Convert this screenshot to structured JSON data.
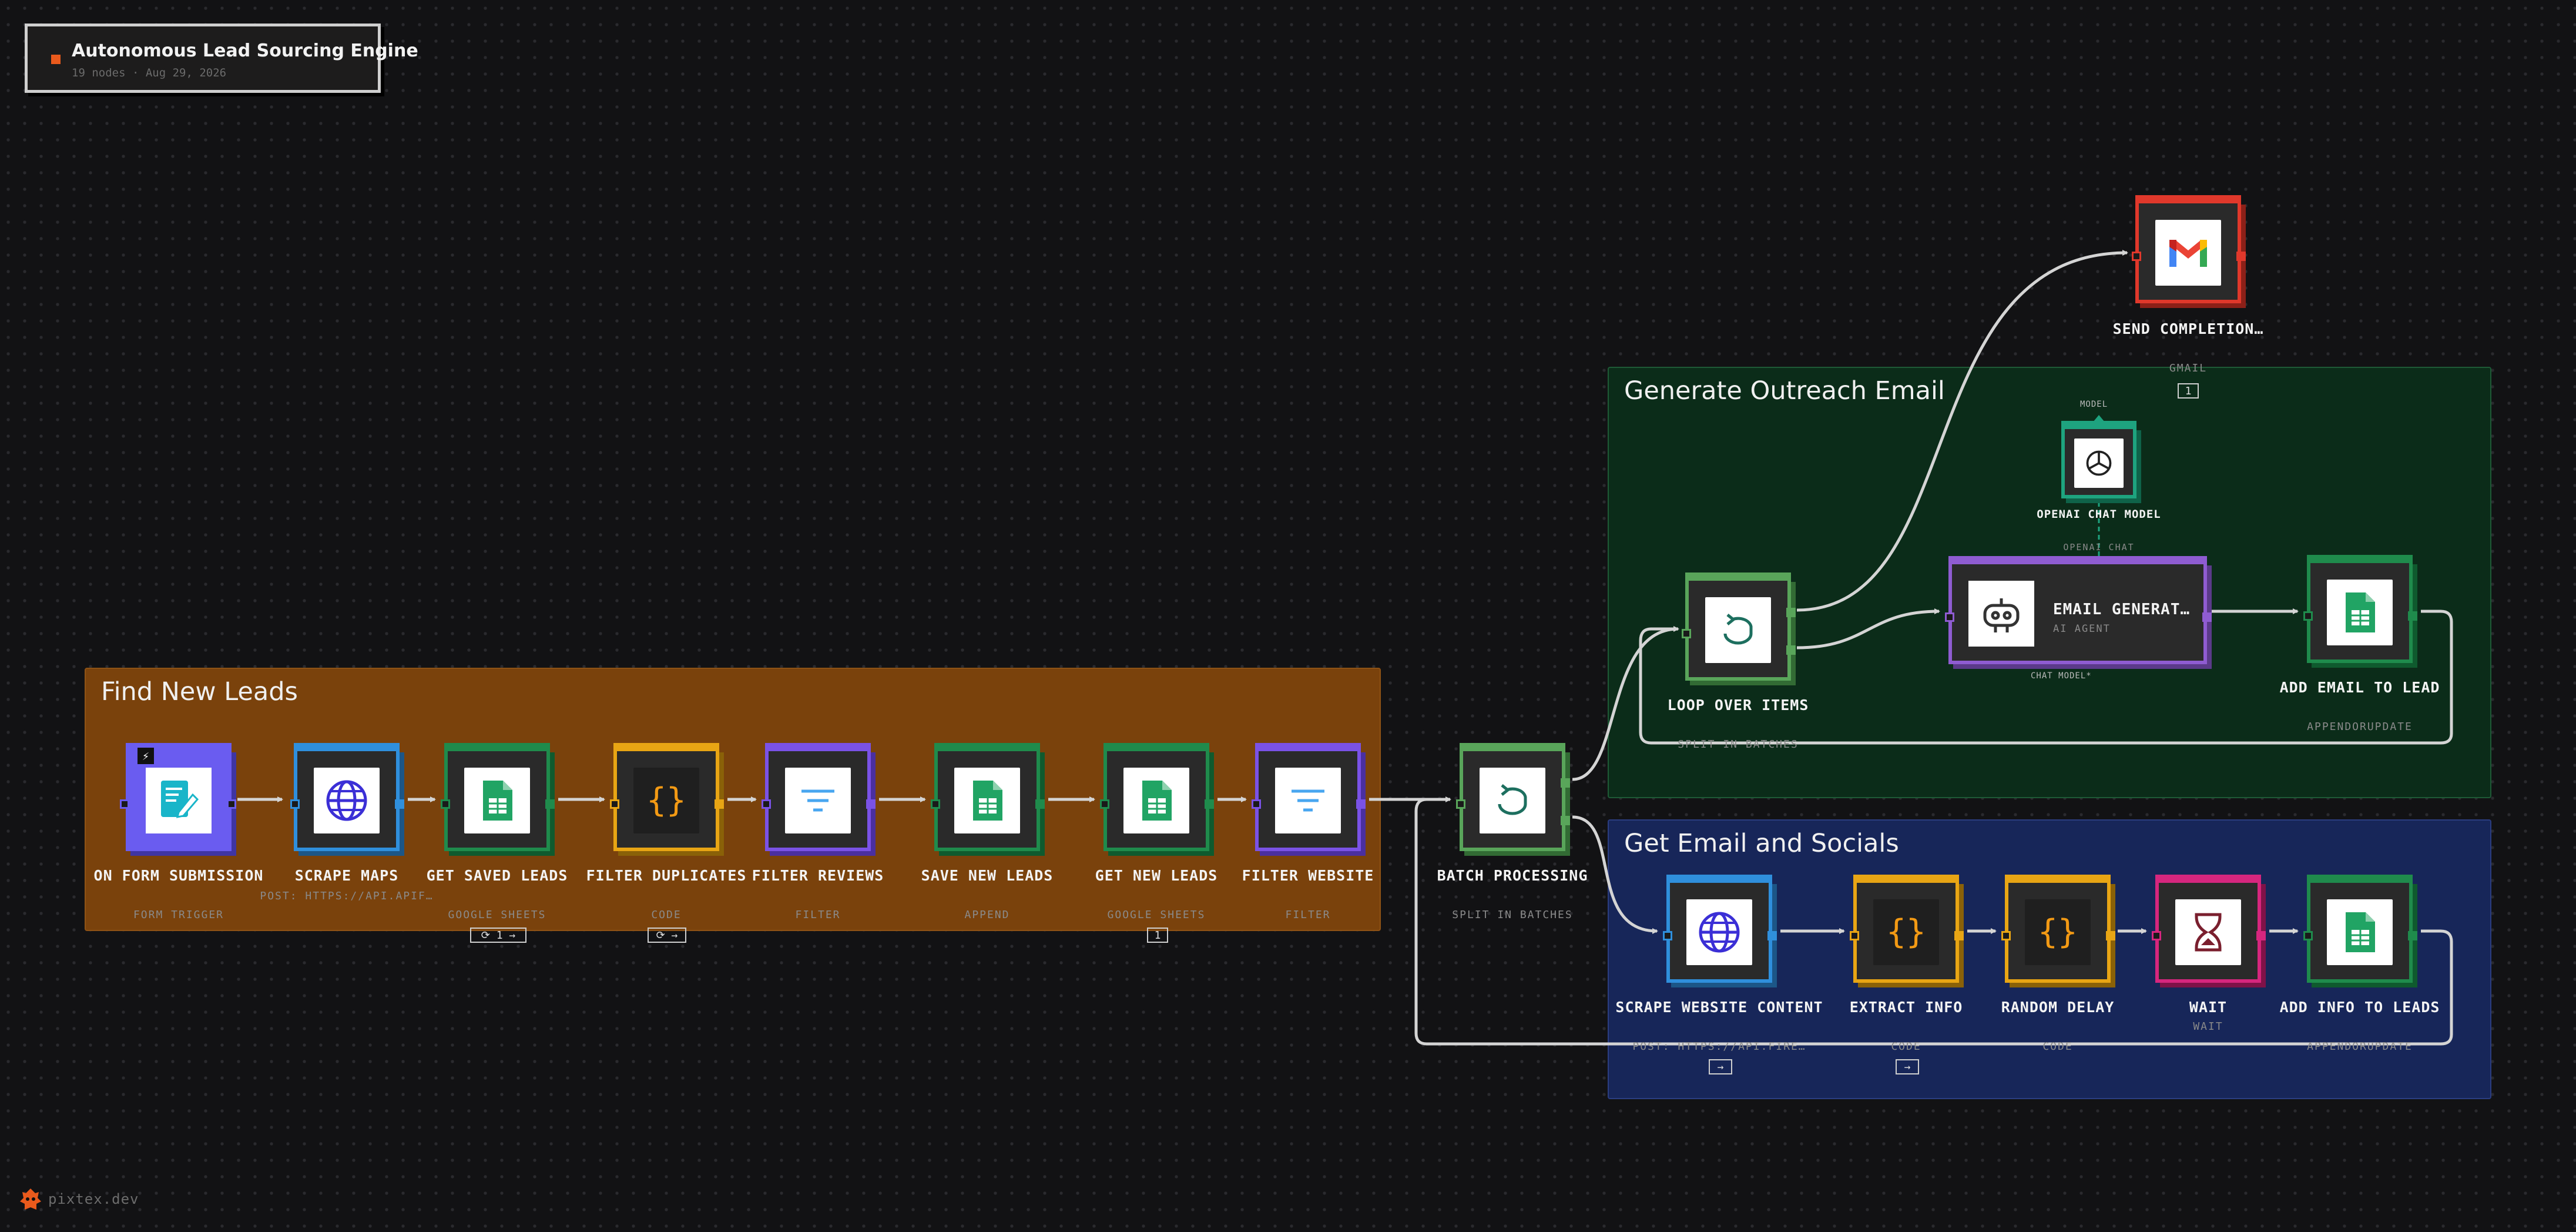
{
  "workflow": {
    "title": "Autonomous Lead Sourcing Engine",
    "subtitle": "19 nodes · Aug 29, 2026"
  },
  "groups": {
    "find": "Find New Leads",
    "generate": "Generate Outreach Email",
    "socials": "Get Email and Socials"
  },
  "nodes": {
    "form": {
      "label": "ON FORM SUBMISSION",
      "sub": "FORM TRIGGER"
    },
    "maps": {
      "label": "SCRAPE MAPS",
      "sub": "POST: HTTPS://API.APIF…"
    },
    "saved": {
      "label": "GET SAVED LEADS",
      "sub": "GOOGLE SHEETS",
      "badge": "⟳ 1 →"
    },
    "dups": {
      "label": "FILTER DUPLICATES",
      "sub": "CODE",
      "badge": "⟳ →"
    },
    "reviews": {
      "label": "FILTER REVIEWS",
      "sub": "FILTER"
    },
    "savenew": {
      "label": "SAVE NEW LEADS",
      "sub": "APPEND"
    },
    "getnew": {
      "label": "GET NEW LEADS",
      "sub": "GOOGLE SHEETS",
      "badge": "1"
    },
    "website": {
      "label": "FILTER WEBSITE",
      "sub": "FILTER"
    },
    "batch": {
      "label": "BATCH PROCESSING",
      "sub": "SPLIT IN BATCHES"
    },
    "loop": {
      "label": "LOOP OVER ITEMS",
      "sub": "SPLIT IN BATCHES"
    },
    "gmail": {
      "label": "SEND COMPLETION…",
      "sub": "GMAIL",
      "badge": "1"
    },
    "openai": {
      "label": "OPENAI CHAT MODEL",
      "sub": "OPENAI CHAT",
      "top": "MODEL"
    },
    "agent": {
      "label": "EMAIL GENERAT…",
      "sub": "AI AGENT",
      "port": "CHAT MODEL*"
    },
    "addemail": {
      "label": "ADD EMAIL TO LEAD",
      "sub": "APPENDORUPDATE"
    },
    "scrapeweb": {
      "label": "SCRAPE WEBSITE CONTENT",
      "sub": "POST: HTTPS://API.FIRE…",
      "badge": "→"
    },
    "extract": {
      "label": "EXTRACT INFO",
      "sub": "CODE",
      "badge": "→"
    },
    "delay": {
      "label": "RANDOM DELAY",
      "sub": "CODE"
    },
    "wait": {
      "label": "WAIT",
      "sub": "WAIT"
    },
    "addinfo": {
      "label": "ADD INFO TO LEADS",
      "sub": "APPENDORUPDATE"
    }
  },
  "colors": {
    "form": "#6a5cf0",
    "http": "#2f8fdc",
    "sheets": "#1f8b4c",
    "code": "#e8a514",
    "filter": "#7a52e6",
    "batch": "#59a55a",
    "gmail": "#e0382b",
    "openai": "#1ea37f",
    "agent": "#8f5cd1",
    "wait": "#d6267e",
    "wire": "#d4d4d4"
  },
  "watermark": "pixtex.dev"
}
